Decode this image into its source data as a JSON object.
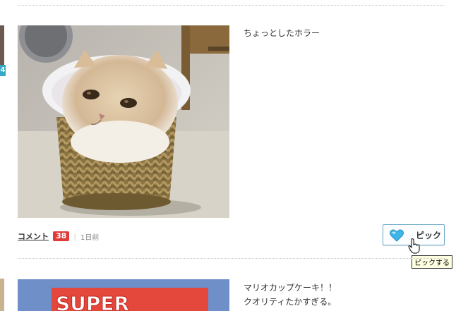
{
  "post1": {
    "caption": "ちょっとしたホラー",
    "meta": {
      "comment_label": "コメント",
      "comment_count": "38",
      "time": "1日前"
    },
    "pick": {
      "label": "ピック",
      "tooltip": "ピックする"
    }
  },
  "post2": {
    "caption_lines": [
      "マリオカップケーキ！！",
      "クオリティたかすぎる。"
    ],
    "photo_text": "SUPER"
  },
  "left_edge": {
    "badge": "4"
  },
  "colors": {
    "count_badge": "#e03b3b",
    "pick_border": "#6aa8c8",
    "heart": "#3fb6e8",
    "tooltip_bg": "#ffffe1"
  }
}
